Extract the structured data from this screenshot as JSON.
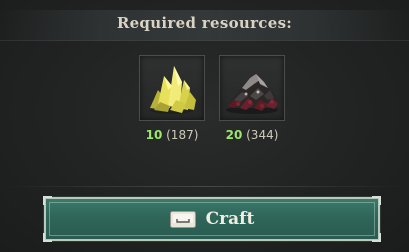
{
  "title": "Required resources:",
  "resources": [
    {
      "icon": "sulfur-crystal-icon",
      "required": "10",
      "owned": "(187)"
    },
    {
      "icon": "coal-ore-pile-icon",
      "required": "20",
      "owned": "(344)"
    }
  ],
  "craft_button": {
    "label": "Craft",
    "key_icon": "spacebar-key-icon"
  },
  "colors": {
    "required_count": "#9be86a",
    "button_fill": "#2f6659",
    "button_border": "#b9c9bd",
    "background": "#212323"
  }
}
